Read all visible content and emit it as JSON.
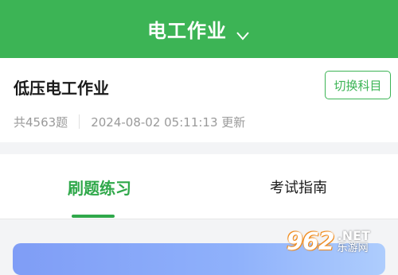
{
  "header": {
    "title": "电工作业"
  },
  "subject": {
    "title": "低压电工作业",
    "switch_label": "切换科目",
    "question_count": "共4563题",
    "updated": "2024-08-02 05:11:13 更新"
  },
  "tabs": [
    {
      "label": "刷题练习",
      "active": true
    },
    {
      "label": "考试指南",
      "active": false
    }
  ],
  "watermark": {
    "number": "962",
    "domain": ".NET",
    "cn": "乐游网"
  },
  "colors": {
    "brand": "#3cb455",
    "tab_active": "#2fa84a"
  }
}
